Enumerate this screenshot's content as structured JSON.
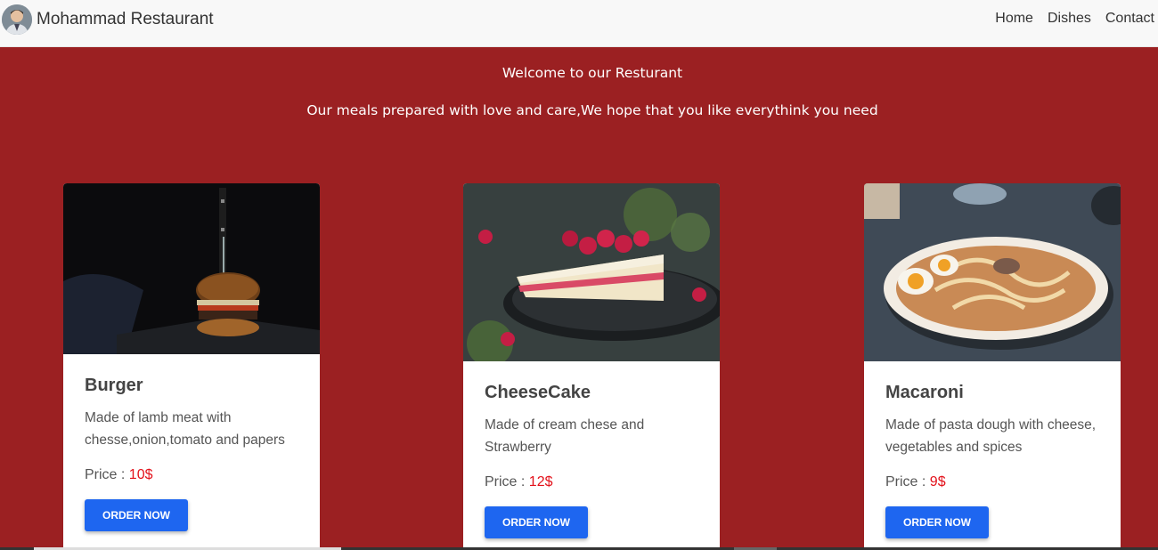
{
  "navbar": {
    "brand": "Mohammad Restaurant",
    "avatar_icon": "profile-photo",
    "links": [
      "Home",
      "Dishes",
      "Contact"
    ]
  },
  "hero": {
    "title": "Welcome to our Resturant",
    "subtitle": "Our meals prepared with love and care,We hope that you like everythink you need"
  },
  "dishes": [
    {
      "name": "Burger",
      "description": "Made of lamb meat with chesse,onion,tomato and papers",
      "price_label": "Price :",
      "price": "10$",
      "button": "ORDER NOW",
      "image_icon": "burger-photo"
    },
    {
      "name": "CheeseCake",
      "description": "Made of cream chese and Strawberry",
      "price_label": "Price :",
      "price": "12$",
      "button": "ORDER NOW",
      "image_icon": "cheesecake-photo"
    },
    {
      "name": "Macaroni",
      "description": "Made of pasta dough with cheese, vegetables and spices",
      "price_label": "Price :",
      "price": "9$",
      "button": "ORDER NOW",
      "image_icon": "noodle-bowl-photo"
    }
  ],
  "colors": {
    "background": "#9b2022",
    "navbar": "#f8f8f8",
    "button": "#1e66f0",
    "price": "#e3111a"
  }
}
